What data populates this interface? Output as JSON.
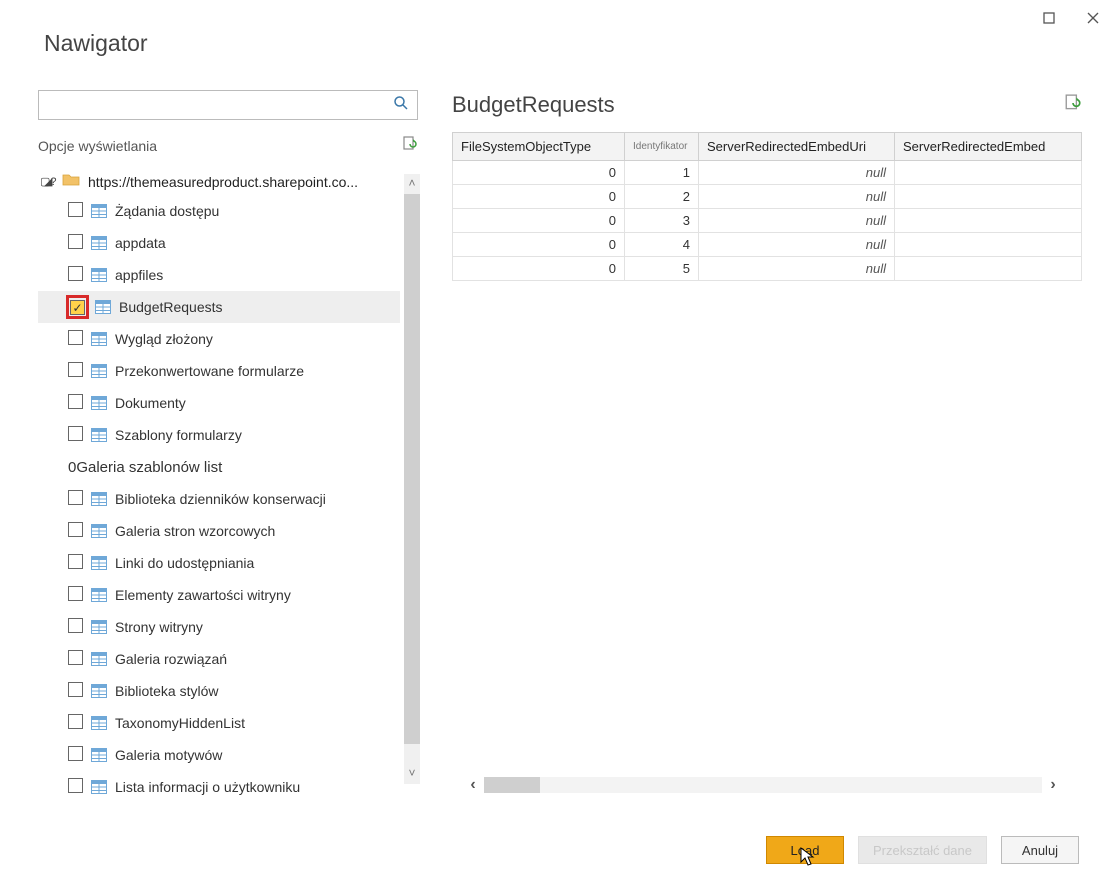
{
  "window_title": "Nawigator",
  "search": {
    "placeholder": ""
  },
  "display_options_label": "Opcje wyświetlania",
  "tree": {
    "root_label": "https://themeasuredproduct.sharepoint.co...",
    "items": [
      {
        "label": "Żądania dostępu",
        "checked": false
      },
      {
        "label": "appdata",
        "checked": false
      },
      {
        "label": "appfiles",
        "checked": false
      },
      {
        "label": "BudgetRequests",
        "checked": true,
        "selected": true,
        "highlight": true
      },
      {
        "label": "Wygląd złożony",
        "checked": false
      },
      {
        "label": "Przekonwertowane formularze",
        "checked": false
      },
      {
        "label": "Dokumenty",
        "checked": false
      },
      {
        "label": "Szablony formularzy",
        "checked": false
      }
    ],
    "sub_header": "0Galeria szablonów list",
    "items2": [
      {
        "label": "Biblioteka dzienników konserwacji",
        "checked": false
      },
      {
        "label": "Galeria stron wzorcowych",
        "checked": false
      },
      {
        "label": "Linki do udostępniania",
        "checked": false
      },
      {
        "label": "Elementy zawartości witryny",
        "checked": false
      },
      {
        "label": "Strony witryny",
        "checked": false
      },
      {
        "label": "Galeria rozwiązań",
        "checked": false
      },
      {
        "label": "Biblioteka stylów",
        "checked": false
      },
      {
        "label": "TaxonomyHiddenList",
        "checked": false
      },
      {
        "label": "Galeria motywów",
        "checked": false
      },
      {
        "label": "Lista informacji o użytkowniku",
        "checked": false
      }
    ]
  },
  "preview": {
    "title": "BudgetRequests",
    "columns": [
      "FileSystemObjectType",
      "Identyfikator",
      "ServerRedirectedEmbedUri",
      "ServerRedirectedEmbed"
    ],
    "rows": [
      {
        "c0": "0",
        "c1": "1",
        "c2": "null",
        "c3": ""
      },
      {
        "c0": "0",
        "c1": "2",
        "c2": "null",
        "c3": ""
      },
      {
        "c0": "0",
        "c1": "3",
        "c2": "null",
        "c3": ""
      },
      {
        "c0": "0",
        "c1": "4",
        "c2": "null",
        "c3": ""
      },
      {
        "c0": "0",
        "c1": "5",
        "c2": "null",
        "c3": ""
      }
    ]
  },
  "footer": {
    "load": "Load",
    "transform": "Przekształć dane",
    "cancel": "Anuluj"
  }
}
